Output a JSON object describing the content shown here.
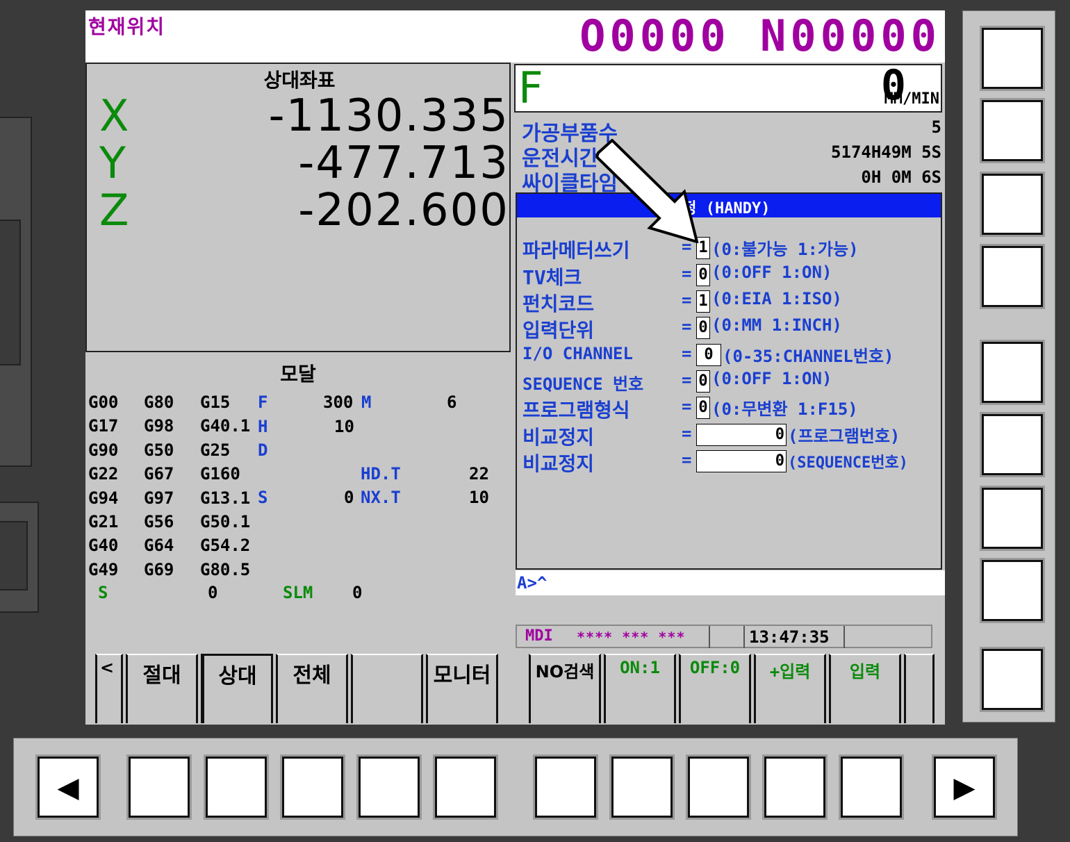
{
  "screen": {
    "title": "현재위치",
    "program": "O0000 N00000"
  },
  "relative": {
    "heading": "상대좌표",
    "axes": [
      {
        "axis": "X",
        "value": "-1130.335"
      },
      {
        "axis": "Y",
        "value": "-477.713"
      },
      {
        "axis": "Z",
        "value": "-202.600"
      }
    ]
  },
  "modal": {
    "heading": "모달",
    "gcodes": [
      [
        "G00",
        "G80",
        "G15"
      ],
      [
        "G17",
        "G98",
        "G40.1"
      ],
      [
        "G90",
        "G50",
        "G25"
      ],
      [
        "G22",
        "G67",
        "G160"
      ],
      [
        "G94",
        "G97",
        "G13.1"
      ],
      [
        "G21",
        "G56",
        "G50.1"
      ],
      [
        "G40",
        "G64",
        "G54.2"
      ],
      [
        "G49",
        "G69",
        "G80.5"
      ]
    ],
    "f_label": "F",
    "f_value": "300",
    "m_label": "M",
    "m_value": "6",
    "h_label": "H",
    "h_value": "10",
    "d_label": "D",
    "hdt_label": "HD.T",
    "hdt_value": "22",
    "s_label": "S",
    "s_value": "0",
    "nxt_label": "NX.T",
    "nxt_value": "10",
    "s2_label": "S",
    "s2_value": "0",
    "slm_label": "SLM",
    "slm_value": "0"
  },
  "feed": {
    "label": "F",
    "value": "0",
    "unit": "MM/MIN"
  },
  "info": [
    {
      "label": "가공부품수",
      "value": "5"
    },
    {
      "label": "운전시간",
      "value": "5174H49M 5S"
    },
    {
      "label": "싸이클타임",
      "value": "0H 0M 6S"
    }
  ],
  "setting": {
    "header": "설정 (HANDY)",
    "rows": [
      {
        "label": "파라메터쓰기",
        "value": "1",
        "hint": "(0:불가능  1:가능)"
      },
      {
        "label": "TV체크",
        "value": "0",
        "hint": "(0:OFF     1:ON)"
      },
      {
        "label": "펀치코드",
        "value": "1",
        "hint": "(0:EIA     1:ISO)"
      },
      {
        "label": "입력단위",
        "value": "0",
        "hint": "(0:MM      1:INCH)"
      },
      {
        "label": "I/O CHANNEL",
        "value": "0",
        "hint": "(0-35:CHANNEL번호)"
      },
      {
        "label": "SEQUENCE 번호",
        "value": "0",
        "hint": "(0:OFF     1:ON)"
      },
      {
        "label": "프로그램형식",
        "value": "0",
        "hint": "(0:무변환  1:F15)"
      },
      {
        "label": "비교정지",
        "value": "0",
        "hint": "(프로그램번호)"
      },
      {
        "label": "비교정지",
        "value": "0",
        "hint": "(SEQUENCE번호)"
      }
    ]
  },
  "command_line": "A>^",
  "status": {
    "mode": "MDI",
    "stars": "**** *** ***",
    "time": "13:47:35"
  },
  "softkeys_left": [
    "<",
    "절대",
    "상대",
    "전체",
    "",
    "모니터"
  ],
  "softkeys_right": [
    "NO검색",
    "ON:1",
    "OFF:0",
    "+입력",
    "입력",
    ""
  ],
  "nav": {
    "prev": "◀",
    "next": "▶"
  }
}
